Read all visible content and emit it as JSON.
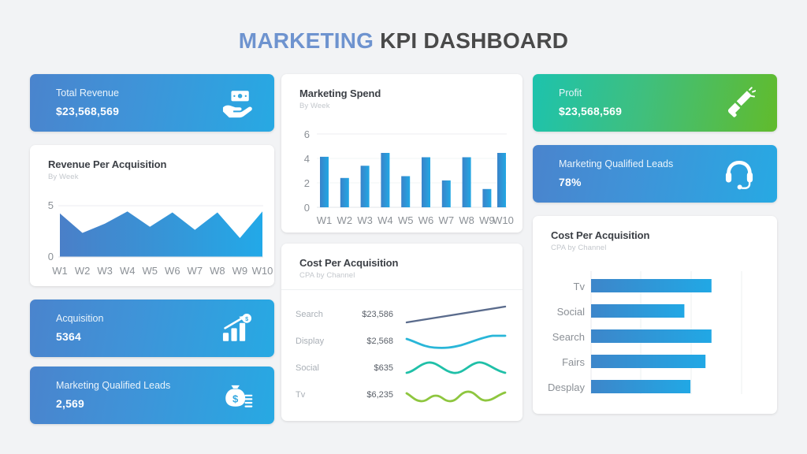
{
  "title": {
    "accent": "MARKETING",
    "rest": " KPI DASHBOARD"
  },
  "colors": {
    "blue_start": "#4a84cd",
    "blue_end": "#27a9e3",
    "green_start": "#1dc3ad",
    "green_end": "#61bb2c",
    "bar_blue": "#2f9fdc",
    "area_start": "#4a7fc8",
    "area_end": "#22a9e8"
  },
  "cards": {
    "total_revenue": {
      "label": "Total Revenue",
      "value": "$23,568,569",
      "icon": "hand-money-icon"
    },
    "acquisition": {
      "label": "Acquisition",
      "value": "5364",
      "icon": "bar-growth-dollar-icon"
    },
    "mql_count": {
      "label": "Marketing Qualified Leads",
      "value": "2,569",
      "icon": "money-bag-icon"
    },
    "profit": {
      "label": "Profit",
      "value": "$23,568,569",
      "icon": "megaphone-icon"
    },
    "mql_percent": {
      "label": "Marketing Qualified Leads",
      "value": "78%",
      "icon": "headset-icon"
    }
  },
  "panels": {
    "revenue_per_acquisition": {
      "title": "Revenue Per Acquisition",
      "subtitle": "By Week"
    },
    "marketing_spend": {
      "title": "Marketing Spend",
      "subtitle": "By Week"
    },
    "cpa_table": {
      "title": "Cost Per Acquisition",
      "subtitle": "CPA by Channel"
    },
    "cpa_bars": {
      "title": "Cost Per Acquisition",
      "subtitle": "CPA by Channel"
    }
  },
  "cpa_channels": [
    {
      "name": "Search",
      "value": "$23,586",
      "color": "#5a6b8c"
    },
    {
      "name": "Display",
      "value": "$2,568",
      "color": "#29b6d8"
    },
    {
      "name": "Social",
      "value": "$635",
      "color": "#20c0a8"
    },
    {
      "name": "Tv",
      "value": "$6,235",
      "color": "#8ec63f"
    }
  ],
  "chart_data": [
    {
      "type": "bar",
      "id": "marketing-spend",
      "title": "Marketing Spend",
      "subtitle": "By Week",
      "xlabel": "",
      "ylabel": "",
      "categories": [
        "W1",
        "W2",
        "W3",
        "W4",
        "W5",
        "W6",
        "W7",
        "W8",
        "W9",
        "W10"
      ],
      "values": [
        4.2,
        2.4,
        3.4,
        4.45,
        2.55,
        4.1,
        2.2,
        4.1,
        1.5,
        4.45
      ],
      "yticks": [
        0,
        2,
        4,
        6
      ],
      "ylim": [
        0,
        6
      ],
      "grid": true,
      "legend": "none"
    },
    {
      "type": "area",
      "id": "revenue-per-acquisition",
      "title": "Revenue Per Acquisition",
      "subtitle": "By Week",
      "xlabel": "",
      "ylabel": "",
      "categories": [
        "W1",
        "W2",
        "W3",
        "W4",
        "W5",
        "W6",
        "W7",
        "W8",
        "W9",
        "W10"
      ],
      "values": [
        4.4,
        2.5,
        3.4,
        4.6,
        2.9,
        4.3,
        2.6,
        4.3,
        1.8,
        4.6
      ],
      "yticks": [
        0,
        5
      ],
      "ylim": [
        0,
        5
      ],
      "grid": true,
      "legend": "none"
    },
    {
      "type": "bar",
      "id": "cpa-by-channel-bars",
      "title": "Cost Per Acquisition",
      "subtitle": "CPA by Channel",
      "orientation": "horizontal",
      "categories": [
        "Tv",
        "Social",
        "Search",
        "Fairs",
        "Desplay"
      ],
      "values": [
        80,
        62,
        80,
        76,
        66
      ],
      "xlim": [
        0,
        100
      ],
      "grid": true,
      "legend": "none"
    },
    {
      "type": "line",
      "id": "cpa-sparklines",
      "title": "Cost Per Acquisition",
      "subtitle": "CPA by Channel",
      "series": [
        {
          "name": "Search",
          "values": [
            1.0,
            1.7,
            2.4,
            3.1,
            3.8,
            4.5
          ],
          "label": "$23,586",
          "color": "#5a6b8c"
        },
        {
          "name": "Display",
          "values": [
            3.0,
            1.9,
            1.4,
            1.4,
            2.9,
            3.4
          ],
          "label": "$2,568",
          "color": "#29b6d8"
        },
        {
          "name": "Social",
          "values": [
            1.4,
            3.2,
            1.5,
            1.6,
            3.3,
            1.4
          ],
          "label": "$635",
          "color": "#20c0a8"
        },
        {
          "name": "Tv",
          "values": [
            2.6,
            1.2,
            2.3,
            1.3,
            2.9,
            1.4
          ],
          "label": "$6,235",
          "color": "#8ec63f"
        }
      ],
      "legend": "left-labels"
    }
  ]
}
